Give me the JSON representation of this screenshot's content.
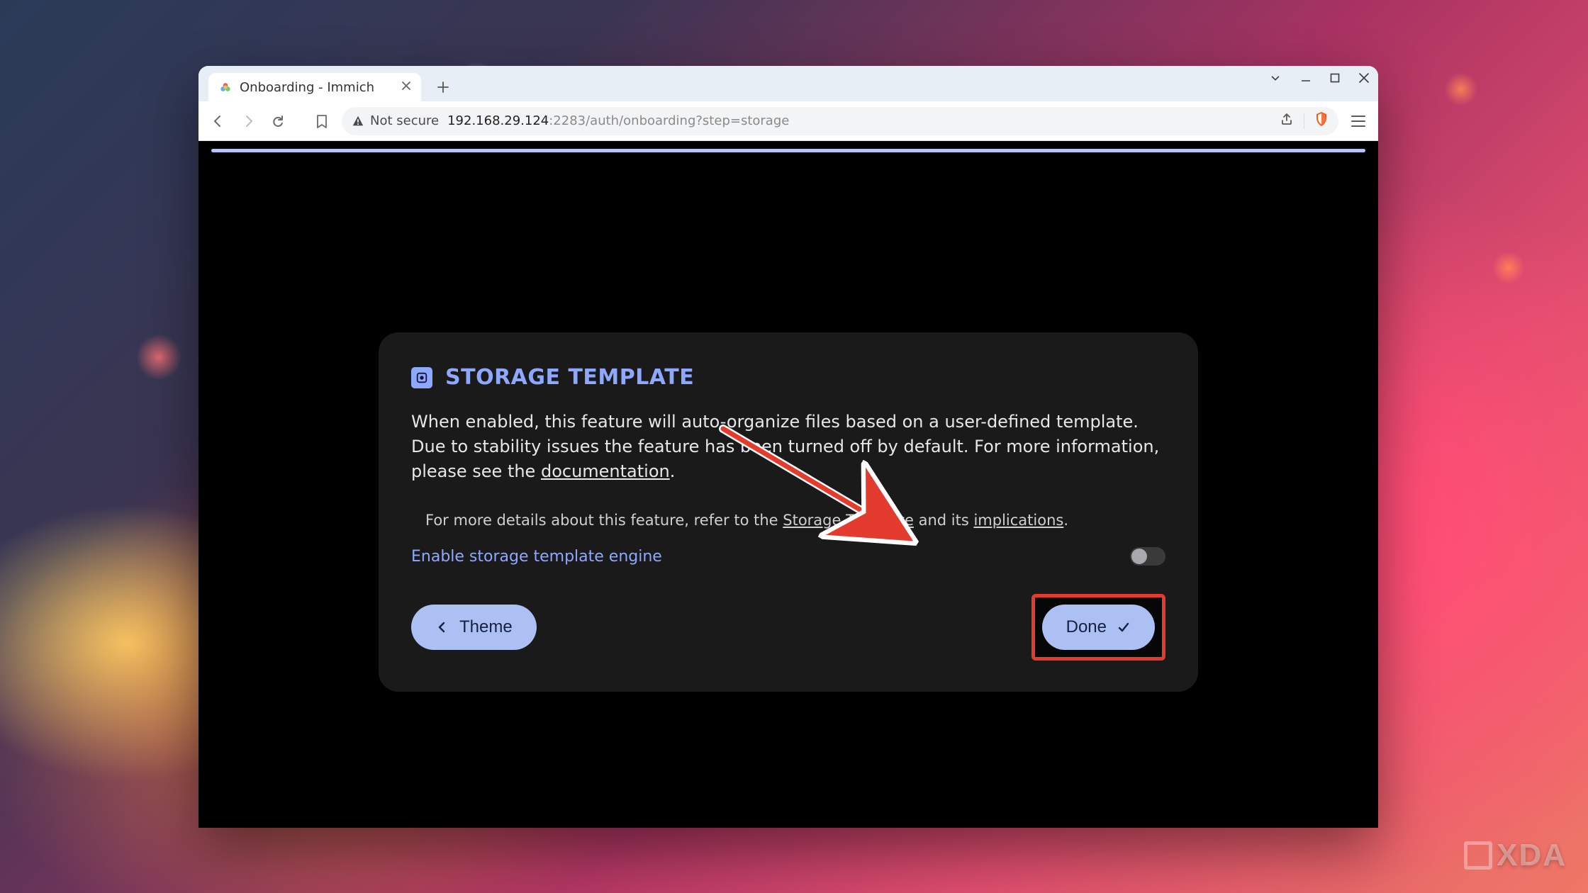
{
  "watermark": "XDA",
  "browser": {
    "tab": {
      "title": "Onboarding - Immich"
    },
    "security_label": "Not secure",
    "url_host": "192.168.29.124",
    "url_port": ":2283",
    "url_path": "/auth/onboarding?step=storage"
  },
  "card": {
    "title": "STORAGE TEMPLATE",
    "desc_pre": "When enabled, this feature will auto-organize files based on a user-defined template. Due to stability issues the feature has been turned off by default. For more information, please see the ",
    "desc_link": "documentation",
    "desc_post": ".",
    "sub_pre": "For more details about this feature, refer to the ",
    "sub_link1": "Storage Template",
    "sub_mid": " and its ",
    "sub_link2": "implications",
    "sub_post": ".",
    "toggle_label": "Enable storage template engine",
    "back_label": "Theme",
    "done_label": "Done"
  }
}
